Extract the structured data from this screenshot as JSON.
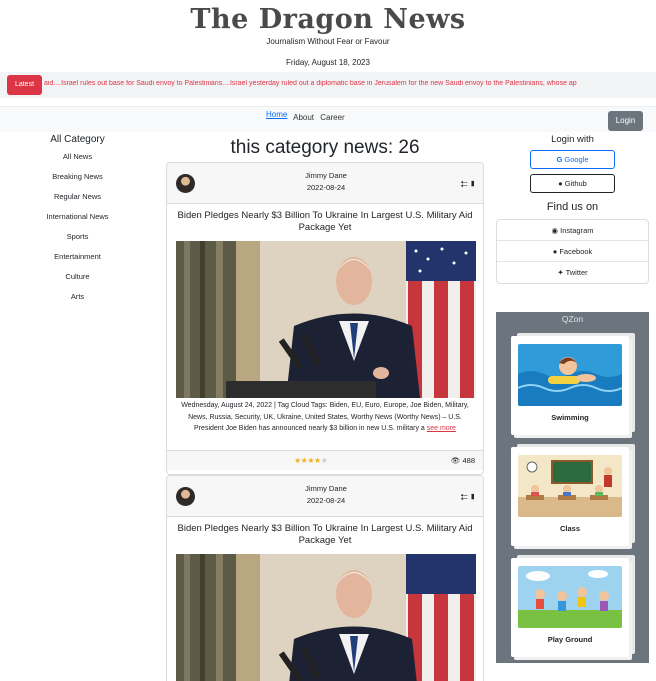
{
  "masthead": {
    "title": "The Dragon News",
    "tagline": "Journalism Without Fear or Favour",
    "date": "Friday, August 18, 2023"
  },
  "ticker": {
    "latest_label": "Latest",
    "text": "aid....Israel rules out base for Saudi envoy to Palestinians....Israel yesterday ruled out a diplomatic base in Jerusalem for the new Saudi envoy to the Palestinians, whose ap"
  },
  "nav": {
    "links": [
      "Home",
      "About",
      "Career"
    ],
    "login_label": "Login"
  },
  "categories": {
    "heading": "All Category",
    "items": [
      "All News",
      "Breaking News",
      "Regular News",
      "International News",
      "Sports",
      "Entertainment",
      "Culture",
      "Arts"
    ]
  },
  "main": {
    "title": "this category news: 26",
    "cards": [
      {
        "author": "Jimmy Dane",
        "date": "2022-08-24",
        "title": "Biden Pledges Nearly $3 Billion To Ukraine In Largest U.S. Military Aid Package Yet",
        "body": "Wednesday, August 24, 2022 | Tag Cloud Tags: Biden, EU, Euro, Europe, Joe Biden, Military, News, Russia, Security, UK, Ukraine, United States, Worthy News (Worthy News) – U.S. President Joe Biden has announced nearly $3 billion in new U.S. military a",
        "see_more": "see more",
        "rating": 4.5,
        "views": "488"
      },
      {
        "author": "Jimmy Dane",
        "date": "2022-08-24",
        "title": "Biden Pledges Nearly $3 Billion To Ukraine In Largest U.S. Military Aid Package Yet"
      }
    ]
  },
  "sidebar_right": {
    "login_heading": "Login with",
    "google_label": "Google",
    "github_label": "Github",
    "find_heading": "Find us on",
    "social": [
      "Instagram",
      "Facebook",
      "Twitter"
    ],
    "qzone_title": "QZon",
    "qzone_items": [
      "Swimming",
      "Class",
      "Play Ground"
    ]
  },
  "colors": {
    "accent_red": "#dc3545",
    "link_blue": "#0d6efd",
    "secondary_gray": "#6c757d",
    "star_gold": "#f2b01e"
  }
}
